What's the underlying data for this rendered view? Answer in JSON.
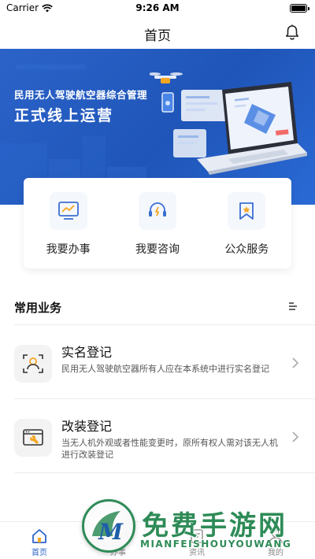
{
  "status_bar": {
    "carrier": "Carrier",
    "time": "9:26 AM"
  },
  "nav": {
    "title": "首页",
    "right_icon": "bell-icon"
  },
  "banner": {
    "subtitle": "民用无人驾驶航空器综合管理",
    "title": "正式线上运营"
  },
  "quick_actions": [
    {
      "label": "我要办事",
      "icon": "chart-monitor-icon"
    },
    {
      "label": "我要咨询",
      "icon": "headset-icon"
    },
    {
      "label": "公众服务",
      "icon": "bookmark-star-icon"
    }
  ],
  "section": {
    "title": "常用业务",
    "icon": "menu-lines-icon"
  },
  "services": [
    {
      "title": "实名登记",
      "description": "民用无人驾驶航空器所有人应在本系统中进行实名登记",
      "icon": "id-person-icon"
    },
    {
      "title": "改装登记",
      "description": "当无人机外观或者性能变更时，原所有权人需对该无人机进行改装登记",
      "icon": "window-wrench-icon"
    }
  ],
  "tabs": [
    {
      "label": "首页",
      "icon": "home-icon",
      "active": true
    },
    {
      "label": "办事",
      "icon": "briefcase-icon",
      "active": false
    },
    {
      "label": "资讯",
      "icon": "news-icon",
      "active": false
    },
    {
      "label": "我的",
      "icon": "user-icon",
      "active": false
    }
  ],
  "watermark": {
    "text_cn": "免费手游网",
    "text_en": "MIANFEISHOUYOUWANG",
    "logo_letter": "M"
  },
  "colors": {
    "primary": "#2b63c9",
    "accent": "#f5a623",
    "watermark": "#2e8b57"
  }
}
